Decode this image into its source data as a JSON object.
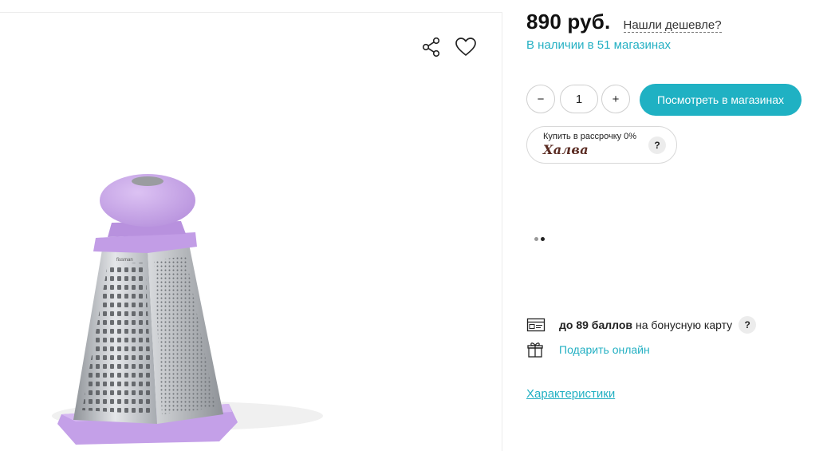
{
  "gallery": {
    "share_icon": "share-icon",
    "favorite_icon": "heart-icon",
    "product_image": "grater-product-image",
    "colors": {
      "accent_lilac": "#c9a6e6",
      "steel": "#b9bcc1"
    }
  },
  "price": {
    "value": "890 руб.",
    "cheaper_link": "Нашли дешевле?"
  },
  "availability": "В наличии в 51 магазинах",
  "quantity": {
    "minus": "−",
    "value": "1",
    "plus": "+"
  },
  "buttons": {
    "view_in_stores": "Посмотреть в магазинах"
  },
  "installment": {
    "label": "Купить в рассрочку 0%",
    "brand": "Халва",
    "help": "?"
  },
  "carousel": {
    "dots": 2,
    "active_index": 1
  },
  "bonus": {
    "amount": "до 89 баллов",
    "suffix": "на бонусную карту",
    "help": "?"
  },
  "gift": {
    "label": "Подарить онлайн"
  },
  "specs_link": "Характеристики",
  "colors": {
    "accent": "#1fb1c3",
    "link": "#24b0c3",
    "halva_brown": "#5a2b22"
  }
}
